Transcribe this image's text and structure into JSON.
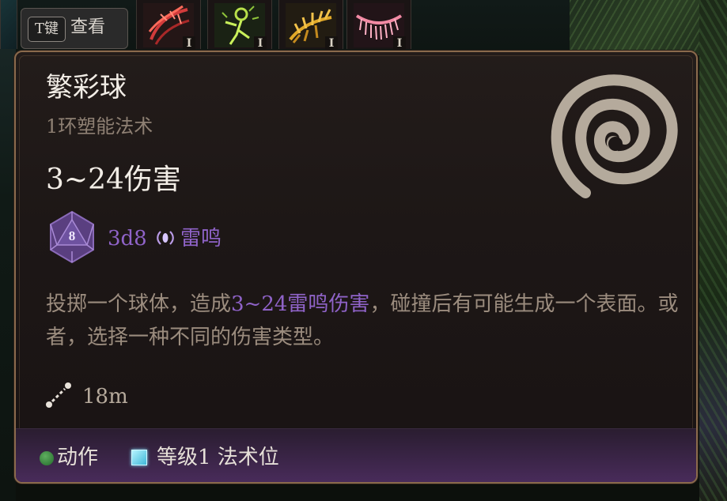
{
  "hotbar": {
    "toggle_key": "T键",
    "toggle_label": "查看",
    "slots": [
      {
        "icon": "red-fire-spell-icon",
        "level": "I"
      },
      {
        "icon": "green-figure-spell-icon",
        "level": "I"
      },
      {
        "icon": "golden-leaf-spell-icon",
        "level": "I"
      },
      {
        "icon": "pink-fringe-spell-icon",
        "level": "I"
      }
    ]
  },
  "tooltip": {
    "title": "繁彩球",
    "subtitle": "1环塑能法术",
    "damage": "3~24伤害",
    "die_face": "8",
    "dice_formula": "3d8",
    "damage_type": "雷鸣",
    "description_before": "投掷一个球体，造成",
    "description_highlight": "3~24雷鸣伤害",
    "description_after": "，碰撞后有可能生成一个表面。或者，选择一种不同的伤害类型。",
    "range": "18m",
    "cost_action": "动作",
    "cost_slot": "等级1 法术位"
  },
  "colors": {
    "border": "#8a6a4c",
    "title": "#f2ede6",
    "subtitle": "#8e8073",
    "thunder": "#8f63c8",
    "description": "#9b8c7e",
    "action_dot": "#3c8c3c",
    "spell_slot": "#7fe3ff"
  }
}
